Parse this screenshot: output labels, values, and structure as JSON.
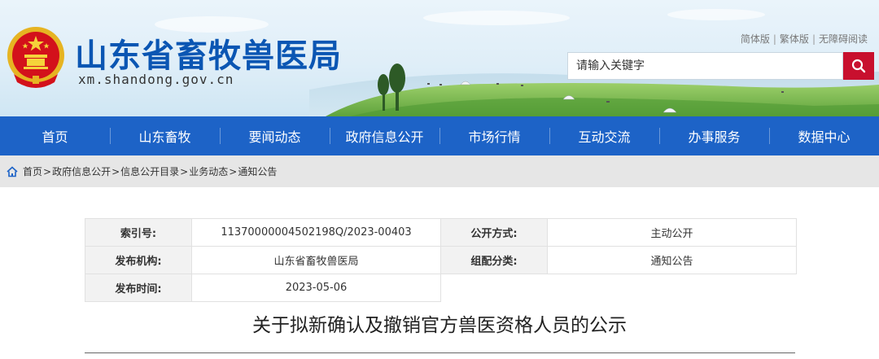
{
  "header": {
    "site_name": "山东省畜牧兽医局",
    "site_domain": "xm.shandong.gov.cn",
    "lang_links": [
      "简体版",
      "繁体版",
      "无障碍阅读"
    ],
    "search_placeholder": "请输入关键字"
  },
  "nav": {
    "items": [
      "首页",
      "山东畜牧",
      "要闻动态",
      "政府信息公开",
      "市场行情",
      "互动交流",
      "办事服务",
      "数据中心"
    ]
  },
  "breadcrumb": {
    "items": [
      "首页",
      "政府信息公开",
      "信息公开目录",
      "业务动态",
      "通知公告"
    ]
  },
  "info": {
    "index_label": "索引号:",
    "index_value": "11370000004502198Q/2023-00403",
    "disclose_label": "公开方式:",
    "disclose_value": "主动公开",
    "publisher_label": "发布机构:",
    "publisher_value": "山东省畜牧兽医局",
    "category_label": "组配分类:",
    "category_value": "通知公告",
    "date_label": "发布时间:",
    "date_value": "2023-05-06"
  },
  "article": {
    "title": "关于拟新确认及撤销官方兽医资格人员的公示"
  },
  "colors": {
    "nav_blue": "#1d63c7",
    "site_name_blue": "#0b56b3",
    "search_red": "#c8102e"
  }
}
